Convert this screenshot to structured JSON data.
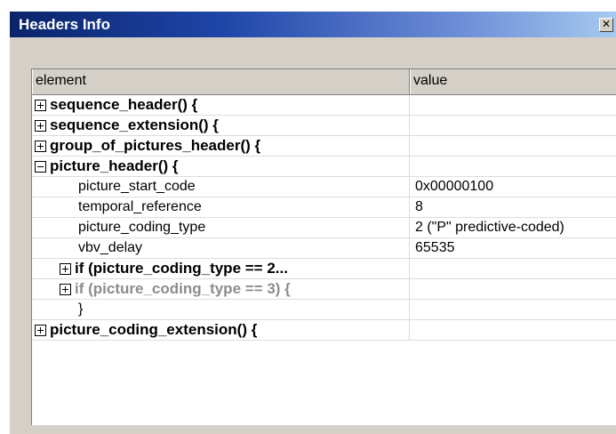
{
  "window": {
    "title": "Headers Info",
    "close_glyph": "✕"
  },
  "table": {
    "columns": [
      "element",
      "value"
    ],
    "rows": [
      {
        "label": "sequence_header() {",
        "value": "",
        "expander": "plus"
      },
      {
        "label": "sequence_extension() {",
        "value": "",
        "expander": "plus"
      },
      {
        "label": "group_of_pictures_header() {",
        "value": "",
        "expander": "plus"
      },
      {
        "label": "picture_header() {",
        "value": "",
        "expander": "minus"
      },
      {
        "label": "picture_start_code",
        "value": "0x00000100"
      },
      {
        "label": "temporal_reference",
        "value": "8"
      },
      {
        "label": "picture_coding_type",
        "value": "2 (\"P\" predictive-coded)"
      },
      {
        "label": "vbv_delay",
        "value": "65535"
      },
      {
        "label": "if (picture_coding_type == 2...",
        "value": "",
        "expander": "plus"
      },
      {
        "label": "if (picture_coding_type == 3) {",
        "value": "",
        "expander": "plus",
        "disabled": true
      },
      {
        "label": "}",
        "value": ""
      },
      {
        "label": "picture_coding_extension() {",
        "value": "",
        "expander": "plus"
      }
    ]
  },
  "colors": {
    "title_gradient_start": "#0a246a",
    "title_gradient_end": "#a6caf0",
    "window_bg": "#d4d0c8",
    "disabled_text": "#8c8c8c"
  }
}
